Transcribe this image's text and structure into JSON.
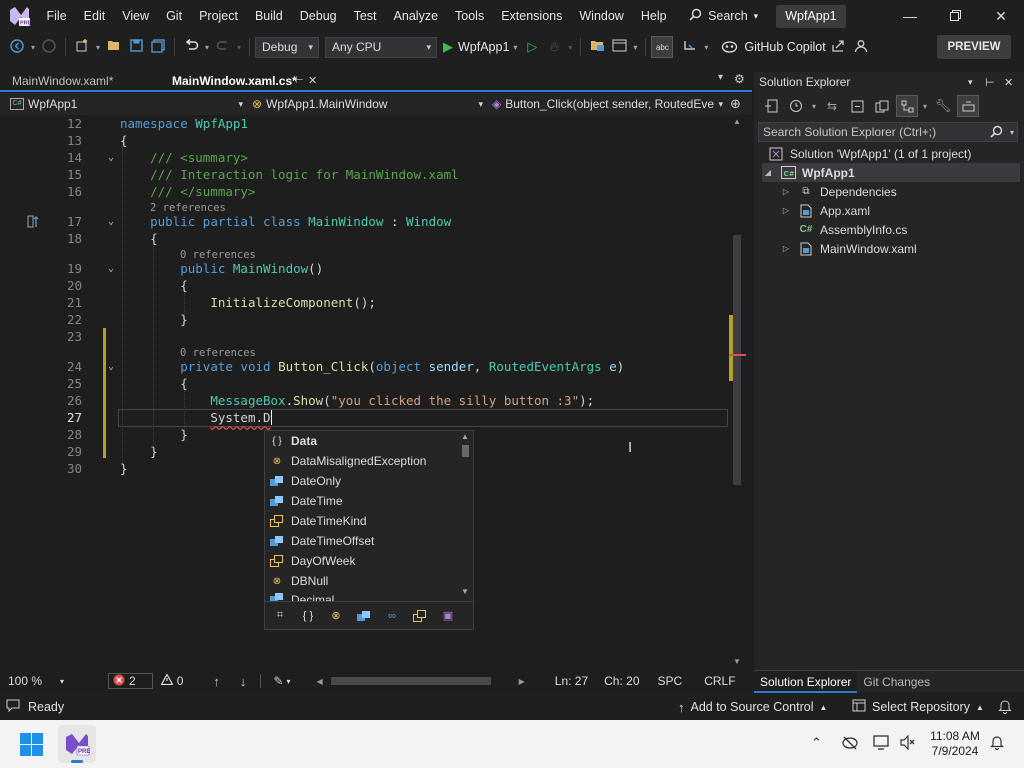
{
  "titlebar": {
    "menus": [
      "File",
      "Edit",
      "View",
      "Git",
      "Project",
      "Build",
      "Debug",
      "Test",
      "Analyze",
      "Tools",
      "Extensions",
      "Window",
      "Help"
    ],
    "search_label": "Search",
    "solution_name": "WpfApp1"
  },
  "toolbar": {
    "config": "Debug",
    "platform": "Any CPU",
    "start_label": "WpfApp1",
    "copilot_label": "GitHub Copilot",
    "preview_label": "PREVIEW"
  },
  "tabs": [
    {
      "label": "MainWindow.xaml*",
      "active": false
    },
    {
      "label": "MainWindow.xaml.cs*",
      "active": true
    }
  ],
  "navbar": {
    "project": "WpfApp1",
    "type": "WpfApp1.MainWindow",
    "member": "Button_Click(object sender, RoutedEve"
  },
  "editor": {
    "line_numbers": [
      "12",
      "13",
      "14",
      "15",
      "16",
      "17",
      "18",
      "19",
      "20",
      "21",
      "22",
      "23",
      "24",
      "25",
      "26",
      "27",
      "28",
      "29",
      "30"
    ],
    "lens": {
      "l17": "2 references",
      "l19": "0 references",
      "l24": "0 references"
    },
    "current_line": 27
  },
  "intellisense": {
    "items": [
      {
        "label": "Data",
        "icon": "namespace-icon",
        "selected": true
      },
      {
        "label": "DataMisalignedException",
        "icon": "class-icon"
      },
      {
        "label": "DateOnly",
        "icon": "struct-icon"
      },
      {
        "label": "DateTime",
        "icon": "struct-icon"
      },
      {
        "label": "DateTimeKind",
        "icon": "enum-icon"
      },
      {
        "label": "DateTimeOffset",
        "icon": "struct-icon"
      },
      {
        "label": "DayOfWeek",
        "icon": "enum-icon"
      },
      {
        "label": "DBNull",
        "icon": "class-icon"
      },
      {
        "label": "Decimal",
        "icon": "struct-icon"
      }
    ]
  },
  "editor_bar": {
    "zoom": "100 %",
    "errors": "2",
    "warnings": "0",
    "line": "Ln: 27",
    "col": "Ch: 20",
    "whitespace": "SPC",
    "eol": "CRLF"
  },
  "solution_explorer": {
    "title": "Solution Explorer",
    "search_placeholder": "Search Solution Explorer (Ctrl+;)",
    "solution": "Solution 'WpfApp1' (1 of 1 project)",
    "project": "WpfApp1",
    "items": [
      "Dependencies",
      "App.xaml",
      "AssemblyInfo.cs",
      "MainWindow.xaml"
    ],
    "bottom_tabs": [
      "Solution Explorer",
      "Git Changes"
    ]
  },
  "status": {
    "ready": "Ready",
    "add_source": "Add to Source Control",
    "select_repo": "Select Repository"
  },
  "taskbar": {
    "time": "11:08 AM",
    "date": "7/9/2024"
  }
}
